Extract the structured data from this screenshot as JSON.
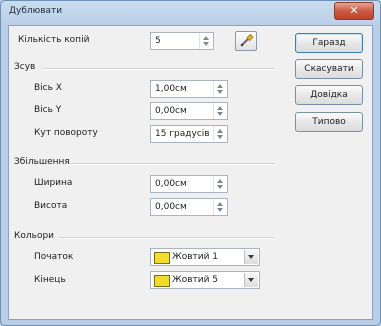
{
  "window": {
    "title": "Дублювати",
    "close_glyph": "✕",
    "accent": "#b9cfe8",
    "close_color": "#cc5b45"
  },
  "copies": {
    "label": "Кількість копій",
    "value": "5"
  },
  "placement": {
    "section": "Зсув",
    "x": {
      "label": "Вісь X",
      "value": "1,00см"
    },
    "y": {
      "label": "Вісь Y",
      "value": "0,00см"
    },
    "angle": {
      "label": "Кут повороту",
      "value": "15 градусів"
    }
  },
  "enlargement": {
    "section": "Збільшення",
    "width": {
      "label": "Ширина",
      "value": "0,00см"
    },
    "height": {
      "label": "Висота",
      "value": "0,00см"
    }
  },
  "colors": {
    "section": "Кольори",
    "start": {
      "label": "Початок",
      "value": "Жовтий 1",
      "swatch": "#f2dc2b"
    },
    "end": {
      "label": "Кінець",
      "value": "Жовтий 5",
      "swatch": "#f2dc2b"
    }
  },
  "buttons": {
    "ok": "Гаразд",
    "cancel": "Скасувати",
    "help": "Довідка",
    "default": "Типово"
  },
  "icons": {
    "values_from_selection": "eyedropper-icon"
  }
}
